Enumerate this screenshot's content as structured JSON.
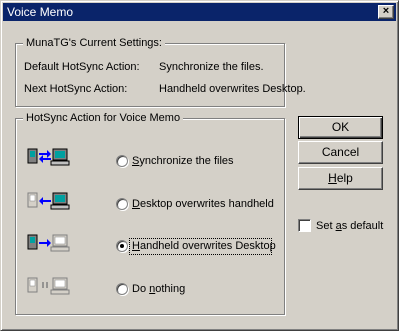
{
  "window": {
    "title": "Voice Memo",
    "close_label": "×"
  },
  "current_settings": {
    "legend": "MunaTG's Current Settings:",
    "default_label": "Default HotSync Action:",
    "default_value": "Synchronize the files.",
    "next_label": "Next HotSync Action:",
    "next_value": "Handheld overwrites Desktop."
  },
  "action_group": {
    "legend": "HotSync Action for Voice Memo",
    "options": [
      {
        "pre": "",
        "mn": "S",
        "post": "ynchronize the files",
        "icon": "sync-both-icon",
        "checked": false
      },
      {
        "pre": "",
        "mn": "D",
        "post": "esktop overwrites handheld",
        "icon": "desktop-overwrites-icon",
        "checked": false
      },
      {
        "pre": "",
        "mn": "H",
        "post": "andheld overwrites Desktop",
        "icon": "handheld-overwrites-icon",
        "checked": true
      },
      {
        "pre": "Do ",
        "mn": "n",
        "post": "othing",
        "icon": "do-nothing-icon",
        "checked": false
      }
    ]
  },
  "buttons": {
    "ok": "OK",
    "cancel": "Cancel",
    "help_mn": "H",
    "help_rest": "elp"
  },
  "set_default": {
    "pre": "Set ",
    "mn": "a",
    "post": "s default",
    "checked": false
  },
  "colors": {
    "title_bg": "#0a246a",
    "face": "#d4d0c8",
    "arrow": "#0000ff"
  }
}
